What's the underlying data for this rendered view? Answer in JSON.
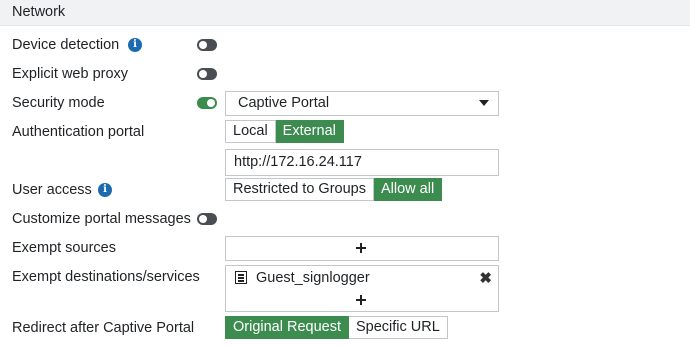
{
  "section": {
    "title": "Network"
  },
  "fields": {
    "device_detection": {
      "label": "Device detection",
      "enabled": false
    },
    "explicit_web_proxy": {
      "label": "Explicit web proxy",
      "enabled": false
    },
    "security_mode": {
      "label": "Security mode",
      "enabled": true,
      "value": "Captive Portal"
    },
    "authentication_portal": {
      "label": "Authentication portal",
      "options": [
        "Local",
        "External"
      ],
      "selected": "External",
      "url": "http://172.16.24.117"
    },
    "user_access": {
      "label": "User access",
      "options": [
        "Restricted to Groups",
        "Allow all"
      ],
      "selected": "Allow all"
    },
    "customize_portal_messages": {
      "label": "Customize portal messages",
      "enabled": false
    },
    "exempt_sources": {
      "label": "Exempt sources",
      "add_symbol": "+"
    },
    "exempt_destinations": {
      "label": "Exempt destinations/services",
      "entries": [
        "Guest_signlogger"
      ],
      "add_symbol": "+"
    },
    "redirect": {
      "label": "Redirect after Captive Portal",
      "options": [
        "Original Request",
        "Specific URL"
      ],
      "selected": "Original Request"
    }
  },
  "icons": {
    "info": "i",
    "remove": "✖"
  },
  "colors": {
    "accent_green": "#3c8c50",
    "info_blue": "#1c6bb0",
    "toggle_off": "#4a4d51"
  }
}
